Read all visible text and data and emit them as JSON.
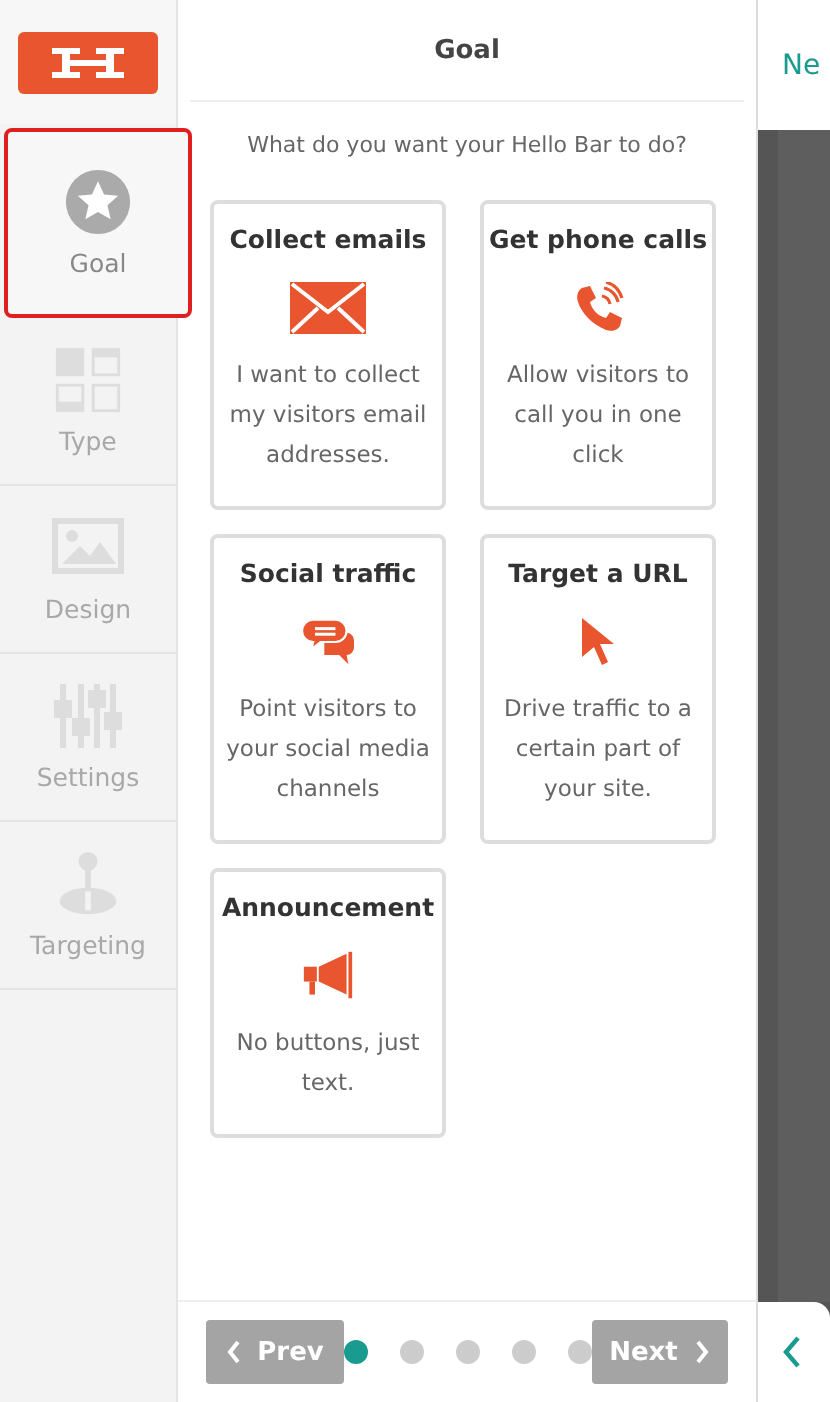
{
  "sidebar": {
    "items": [
      {
        "label": "Goal",
        "kind": "star",
        "selected": true
      },
      {
        "label": "Type",
        "kind": "layout",
        "selected": false
      },
      {
        "label": "Design",
        "kind": "image",
        "selected": false
      },
      {
        "label": "Settings",
        "kind": "sliders",
        "selected": false
      },
      {
        "label": "Targeting",
        "kind": "joystick",
        "selected": false
      }
    ]
  },
  "panel": {
    "title": "Goal",
    "question": "What do you want your Hello Bar to do?",
    "options": [
      {
        "title": "Collect emails",
        "kind": "email",
        "description": "I want to collect my visitors email addresses."
      },
      {
        "title": "Get phone calls",
        "kind": "phone",
        "description": "Allow visitors to call you in one click"
      },
      {
        "title": "Social traffic",
        "kind": "social",
        "description": "Point visitors to your social media channels"
      },
      {
        "title": "Target a URL",
        "kind": "pointer",
        "description": "Drive traffic to a certain part of your site."
      },
      {
        "title": "Announcement",
        "kind": "megaphone",
        "description": "No buttons, just text."
      }
    ]
  },
  "footer": {
    "prev": "Prev",
    "next": "Next",
    "steps": [
      {
        "selected": true
      },
      {
        "selected": false
      },
      {
        "selected": false
      },
      {
        "selected": false
      },
      {
        "selected": false
      }
    ]
  },
  "preview": {
    "tab": "Ne"
  }
}
